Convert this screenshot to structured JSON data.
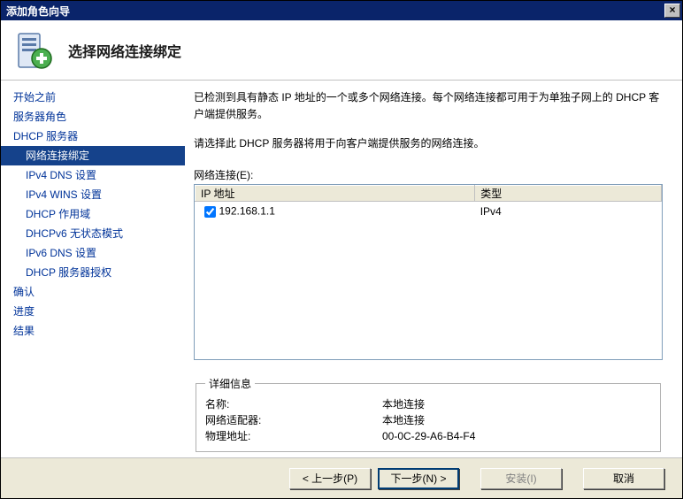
{
  "title": "添加角色向导",
  "heading": "选择网络连接绑定",
  "sidebar": {
    "items": [
      {
        "label": "开始之前",
        "sub": false
      },
      {
        "label": "服务器角色",
        "sub": false
      },
      {
        "label": "DHCP 服务器",
        "sub": false
      },
      {
        "label": "网络连接绑定",
        "sub": true,
        "selected": true
      },
      {
        "label": "IPv4 DNS 设置",
        "sub": true
      },
      {
        "label": "IPv4 WINS 设置",
        "sub": true
      },
      {
        "label": "DHCP 作用域",
        "sub": true
      },
      {
        "label": "DHCPv6 无状态模式",
        "sub": true
      },
      {
        "label": "IPv6 DNS 设置",
        "sub": true
      },
      {
        "label": "DHCP 服务器授权",
        "sub": true
      },
      {
        "label": "确认",
        "sub": false
      },
      {
        "label": "进度",
        "sub": false
      },
      {
        "label": "结果",
        "sub": false
      }
    ]
  },
  "content": {
    "desc1": "已检测到具有静态 IP 地址的一个或多个网络连接。每个网络连接都可用于为单独子网上的 DHCP 客户端提供服务。",
    "desc2": "请选择此 DHCP 服务器将用于向客户端提供服务的网络连接。",
    "conn_label": "网络连接(E):",
    "col_ip": "IP 地址",
    "col_type": "类型",
    "rows": [
      {
        "checked": true,
        "ip": "192.168.1.1",
        "type": "IPv4"
      }
    ],
    "details_title": "详细信息",
    "details": [
      {
        "k": "名称:",
        "v": "本地连接"
      },
      {
        "k": "网络适配器:",
        "v": "本地连接"
      },
      {
        "k": "物理地址:",
        "v": "00-0C-29-A6-B4-F4"
      }
    ]
  },
  "buttons": {
    "prev": "< 上一步(P)",
    "next": "下一步(N) >",
    "install": "安装(I)",
    "cancel": "取消"
  }
}
